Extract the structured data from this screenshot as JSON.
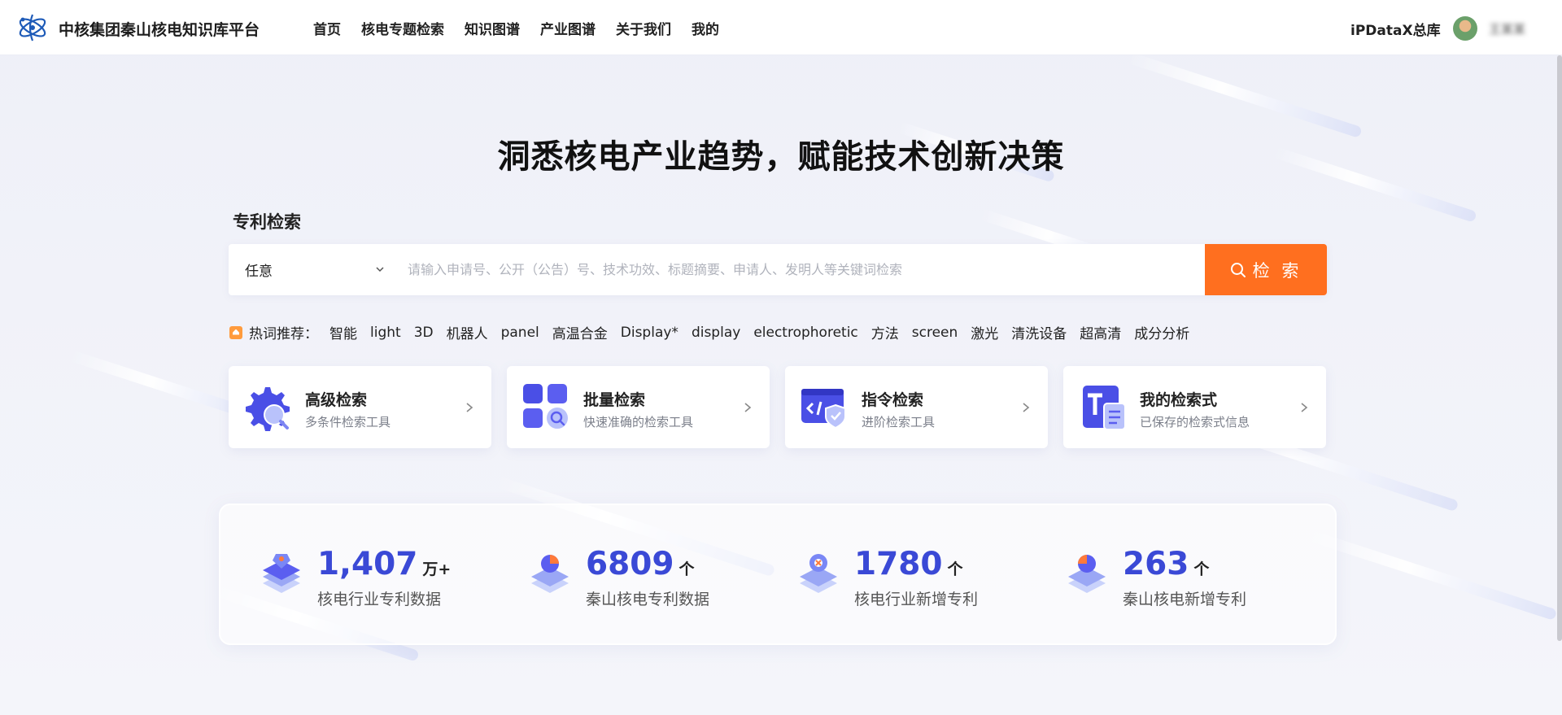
{
  "header": {
    "brand": "中核集团秦山核电知识库平台",
    "nav": [
      "首页",
      "核电专题检索",
      "知识图谱",
      "产业图谱",
      "关于我们",
      "我的"
    ],
    "org": "iPDataX总库",
    "username": "王某某"
  },
  "hero": {
    "headline": "洞悉核电产业趋势，赋能技术创新决策"
  },
  "search": {
    "section_label": "专利检索",
    "field_select": "任意",
    "placeholder": "请输入申请号、公开（公告）号、技术功效、标题摘要、申请人、发明人等关键词检索",
    "button_label": "检 索"
  },
  "hotwords": {
    "label": "热词推荐：",
    "items": [
      "智能",
      "light",
      "3D",
      "机器人",
      "panel",
      "高温合金",
      "Display*",
      "display",
      "electrophoretic",
      "方法",
      "screen",
      "激光",
      "清洗设备",
      "超高清",
      "成分分析"
    ]
  },
  "cards": [
    {
      "title": "高级检索",
      "subtitle": "多条件检索工具",
      "icon": "gear-search-icon"
    },
    {
      "title": "批量检索",
      "subtitle": "快速准确的检索工具",
      "icon": "grid-search-icon"
    },
    {
      "title": "指令检索",
      "subtitle": "进阶检索工具",
      "icon": "code-shield-icon"
    },
    {
      "title": "我的检索式",
      "subtitle": "已保存的检索式信息",
      "icon": "text-document-icon"
    }
  ],
  "stats": [
    {
      "value": "1,407",
      "unit": "万+",
      "label": "核电行业专利数据"
    },
    {
      "value": "6809",
      "unit": "个",
      "label": "秦山核电专利数据"
    },
    {
      "value": "1780",
      "unit": "个",
      "label": "核电行业新增专利"
    },
    {
      "value": "263",
      "unit": "个",
      "label": "秦山核电新增专利"
    }
  ],
  "colors": {
    "accent": "#ff6f1f",
    "stat_number": "#3a49d6",
    "icon_primary": "#5b5ef0"
  }
}
